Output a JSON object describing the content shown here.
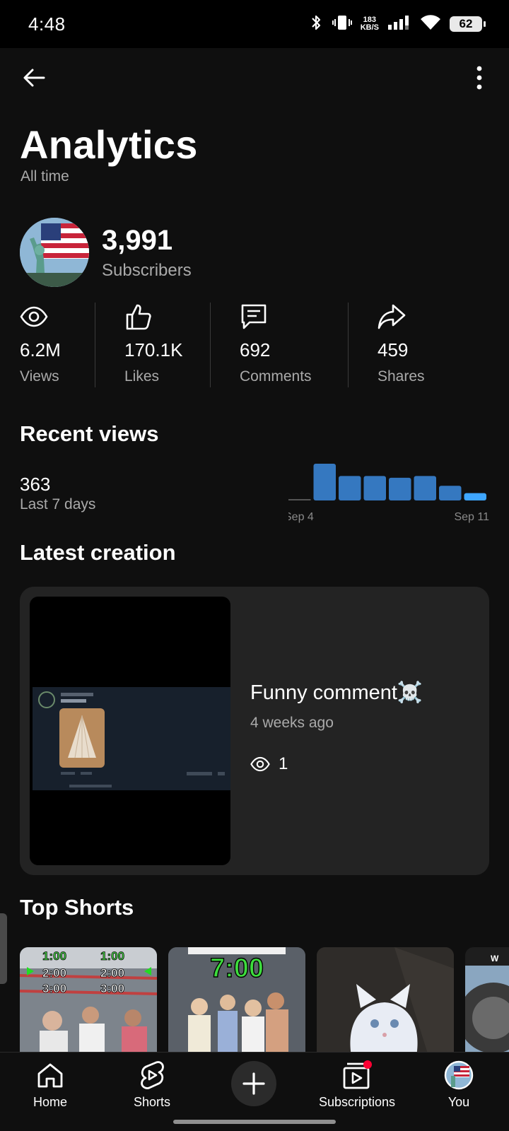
{
  "status_bar": {
    "time": "4:48",
    "network_speed_value": "183",
    "network_speed_unit": "KB/S",
    "battery": "62",
    "icons": [
      "bluetooth-icon",
      "vibrate-icon",
      "signal-icon",
      "wifi-icon",
      "battery-icon"
    ]
  },
  "header": {
    "back_icon": "arrow-left-icon",
    "more_icon": "more-vert-icon",
    "title": "Analytics",
    "subtitle": "All time"
  },
  "channel": {
    "subscriber_count": "3,991",
    "subscriber_label": "Subscribers"
  },
  "stats": [
    {
      "icon": "eye-icon",
      "value": "6.2M",
      "label": "Views"
    },
    {
      "icon": "thumbs-up-icon",
      "value": "170.1K",
      "label": "Likes"
    },
    {
      "icon": "comment-icon",
      "value": "692",
      "label": "Comments"
    },
    {
      "icon": "share-icon",
      "value": "459",
      "label": "Shares"
    }
  ],
  "recent_views": {
    "title": "Recent views",
    "count": "363",
    "period": "Last 7 days"
  },
  "chart_data": {
    "type": "bar",
    "x_start_label": "Sep 4",
    "x_end_label": "Sep 11",
    "values": [
      0,
      60,
      40,
      40,
      37,
      40,
      24,
      12
    ],
    "colors": {
      "bar": "#3578c0",
      "last_bar": "#3ea6ff",
      "baseline": "#555555"
    }
  },
  "latest_creation": {
    "title": "Latest creation",
    "video_title": "Funny comment☠️",
    "age": "4 weeks ago",
    "views": "1"
  },
  "top_shorts": {
    "title": "Top Shorts",
    "items": [
      {
        "overlay_lines": [
          "1:00",
          "2:00",
          "3:00"
        ],
        "overlay_lines_b": [
          "1:00",
          "2:00",
          "3:00"
        ]
      },
      {
        "caption": "7:00"
      },
      {
        "caption": ""
      },
      {
        "caption": "W"
      }
    ]
  },
  "bottom_nav": {
    "items": [
      {
        "label": "Home",
        "icon": "home-icon"
      },
      {
        "label": "Shorts",
        "icon": "shorts-icon"
      },
      {
        "label": "",
        "icon": "plus-icon"
      },
      {
        "label": "Subscriptions",
        "icon": "subscriptions-icon"
      },
      {
        "label": "You",
        "icon": "avatar-icon"
      }
    ]
  }
}
